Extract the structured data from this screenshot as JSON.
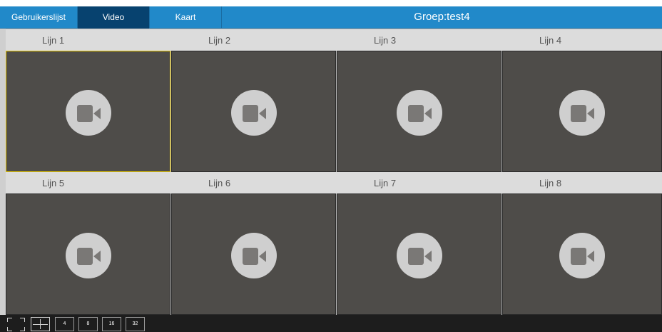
{
  "header": {
    "tabs": [
      {
        "label": "Gebruikerslijst",
        "active": false
      },
      {
        "label": "Video",
        "active": true
      },
      {
        "label": "Kaart",
        "active": false
      }
    ],
    "group_title": "Groep:test4"
  },
  "grid": {
    "row1": [
      "Lijn 1",
      "Lijn 2",
      "Lijn 3",
      "Lijn 4"
    ],
    "row2": [
      "Lijn 5",
      "Lijn 6",
      "Lijn 7",
      "Lijn 8"
    ],
    "selected_index": 0
  },
  "toolbar": {
    "layouts": [
      "4",
      "8",
      "16",
      "32"
    ]
  },
  "colors": {
    "header_bg": "#2189c9",
    "active_tab": "#07426f",
    "cell_bg": "#4e4c49",
    "selected_border": "#e5c600"
  }
}
